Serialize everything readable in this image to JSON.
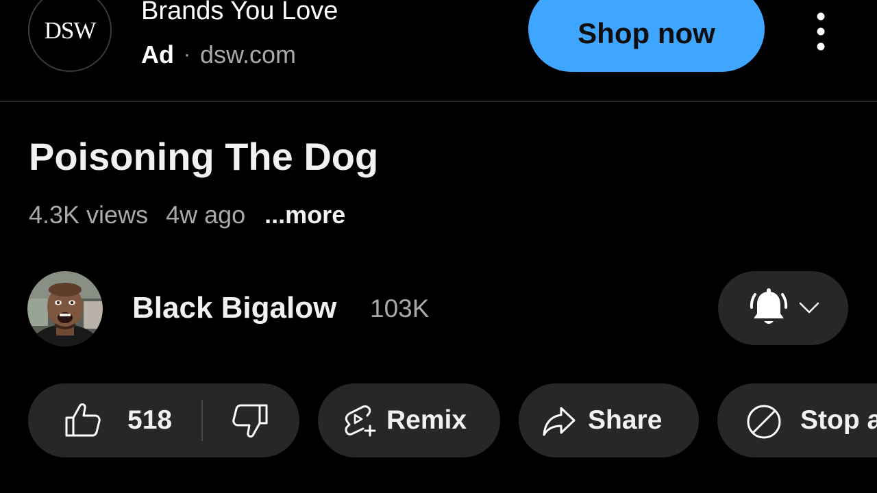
{
  "ad": {
    "logo_text": "DSW",
    "headline": "Brands You Love",
    "badge": "Ad",
    "separator": "·",
    "domain": "dsw.com",
    "cta_label": "Shop now",
    "cta_color": "#3ea6ff",
    "menu_icon": "more-vertical-icon"
  },
  "video": {
    "title": "Poisoning The Dog",
    "views": "4.3K views",
    "age": "4w ago",
    "more_label": "...more"
  },
  "channel": {
    "name": "Black Bigalow",
    "subscribers": "103K",
    "notify_icon": "bell-icon",
    "dropdown_icon": "chevron-down-icon"
  },
  "actions": {
    "like_count": "518",
    "like_icon": "thumbs-up-icon",
    "dislike_icon": "thumbs-down-icon",
    "remix_label": "Remix",
    "remix_icon": "remix-icon",
    "share_label": "Share",
    "share_icon": "share-icon",
    "stop_label": "Stop ads",
    "stop_icon": "block-icon"
  },
  "colors": {
    "background": "#000000",
    "chip_background": "#272727",
    "secondary_text": "#aaaaaa"
  }
}
